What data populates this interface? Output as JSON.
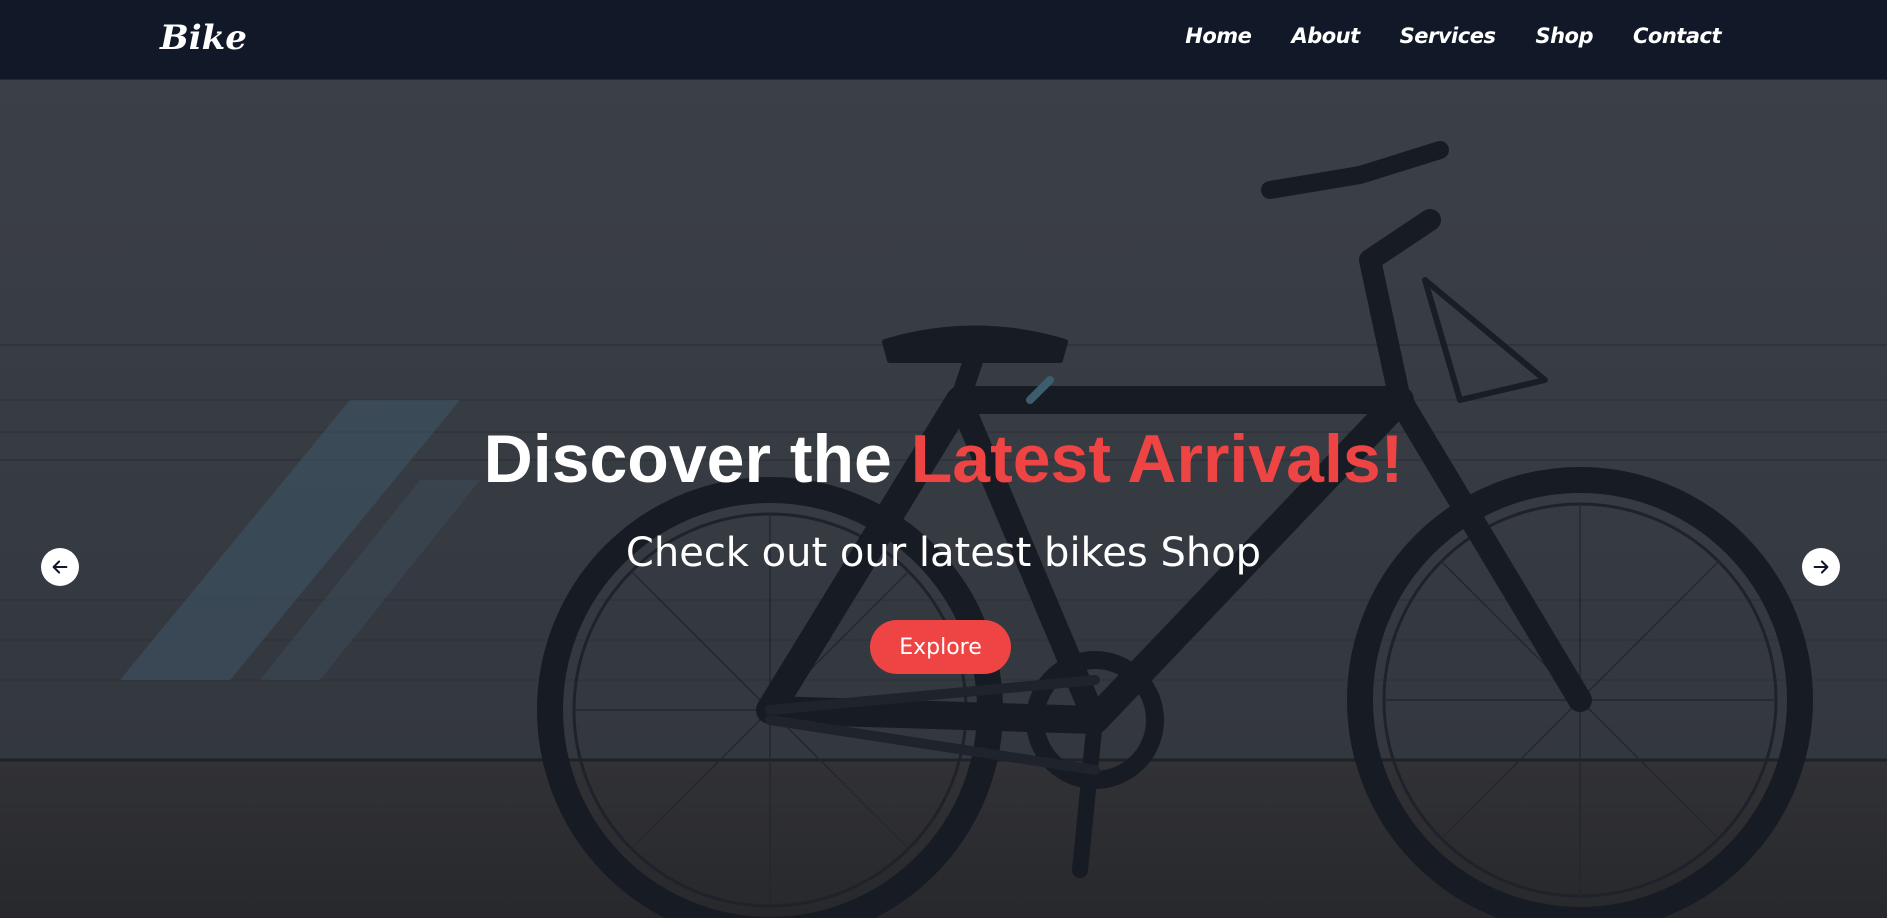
{
  "brand": {
    "logo_text": "Bike"
  },
  "nav": {
    "links": [
      {
        "label": "Home"
      },
      {
        "label": "About"
      },
      {
        "label": "Services"
      },
      {
        "label": "Shop"
      },
      {
        "label": "Contact"
      }
    ]
  },
  "hero": {
    "title_prefix": "Discover the ",
    "title_highlight": "Latest Arrivals!",
    "subtitle": "Check out our latest bikes Shop",
    "cta_label": "Explore",
    "background_image": "black-bicycle-against-concrete-wall",
    "prev_icon": "arrow-left-icon",
    "next_icon": "arrow-right-icon"
  },
  "colors": {
    "navbar_bg": "#111827",
    "accent": "#ef4444",
    "text": "#ffffff"
  }
}
